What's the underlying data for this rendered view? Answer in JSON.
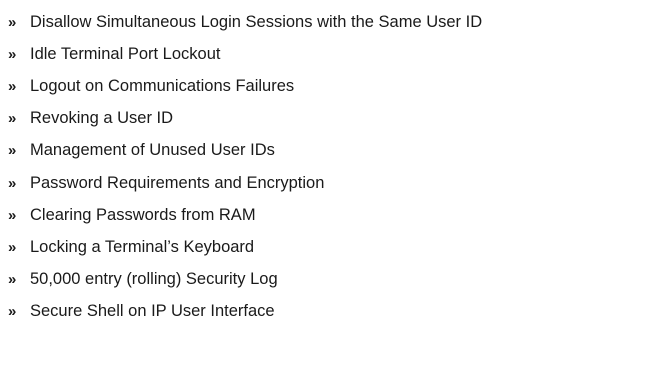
{
  "bullet_glyph": "»",
  "items": [
    "Disallow Simultaneous Login Sessions with the Same User ID",
    "Idle Terminal Port Lockout",
    "Logout on Communications Failures",
    "Revoking a User ID",
    "Management of Unused User IDs",
    "Password Requirements and Encryption",
    "Clearing Passwords from RAM",
    "Locking a Terminal’s Keyboard",
    "50,000 entry (rolling) Security Log",
    "Secure Shell on IP User Interface"
  ]
}
